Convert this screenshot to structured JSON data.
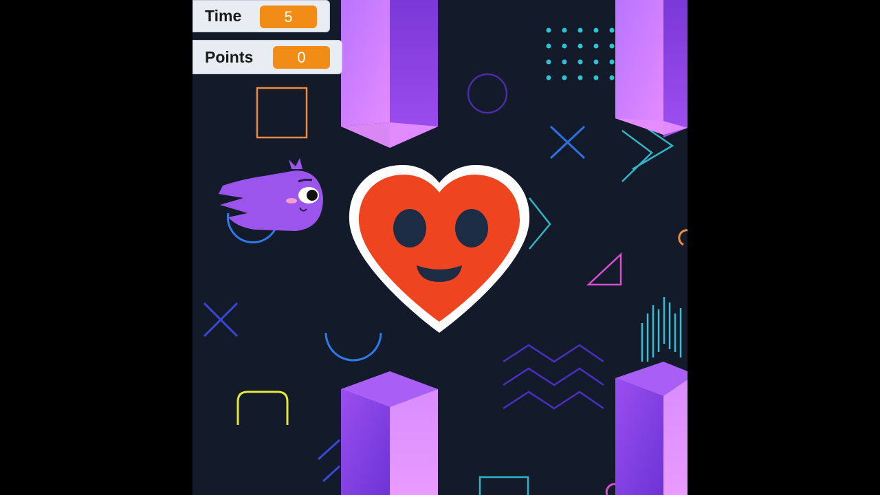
{
  "monitors": {
    "time": {
      "label": "Time",
      "value": "5"
    },
    "points": {
      "label": "Points",
      "value": "0"
    }
  },
  "colors": {
    "stage_background": "#131b2b",
    "monitor_value": "#f18d17",
    "pillar_light": "#e58cff",
    "pillar_dark": "#8a3fe0",
    "heart_red": "#ee4520",
    "player_purple": "#9b55ec"
  },
  "sprites": {
    "player": "purple-comet-character",
    "target": "smiling-heart",
    "obstacles": "purple-pillar"
  }
}
